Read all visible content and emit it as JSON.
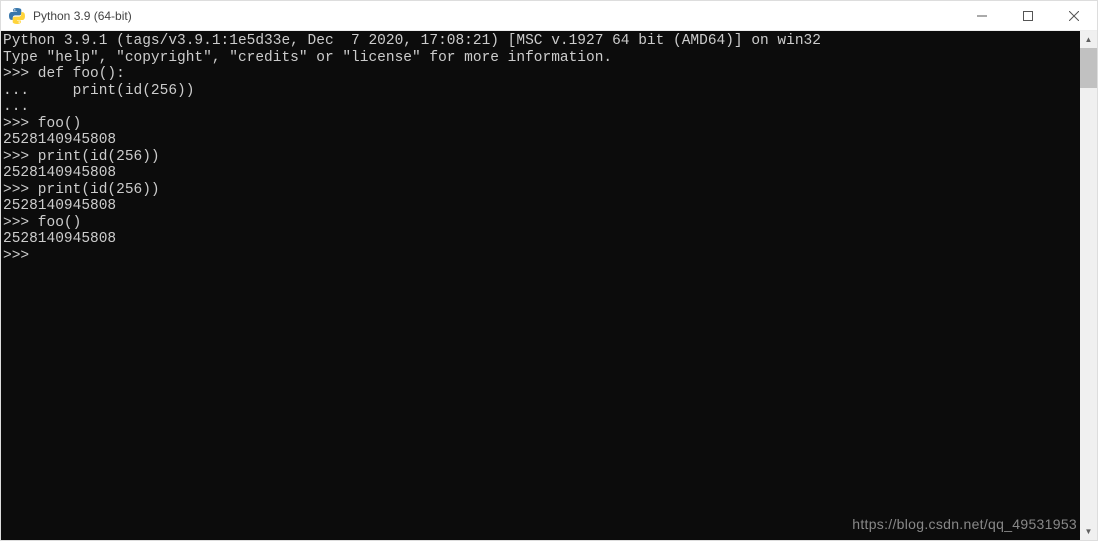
{
  "window": {
    "title": "Python 3.9 (64-bit)"
  },
  "terminal": {
    "lines": [
      "Python 3.9.1 (tags/v3.9.1:1e5d33e, Dec  7 2020, 17:08:21) [MSC v.1927 64 bit (AMD64)] on win32",
      "Type \"help\", \"copyright\", \"credits\" or \"license\" for more information.",
      ">>> def foo():",
      "...     print(id(256))",
      "...",
      ">>> foo()",
      "2528140945808",
      ">>> print(id(256))",
      "2528140945808",
      ">>> print(id(256))",
      "2528140945808",
      ">>> foo()",
      "2528140945808",
      ">>> "
    ]
  },
  "watermark": "https://blog.csdn.net/qq_49531953"
}
